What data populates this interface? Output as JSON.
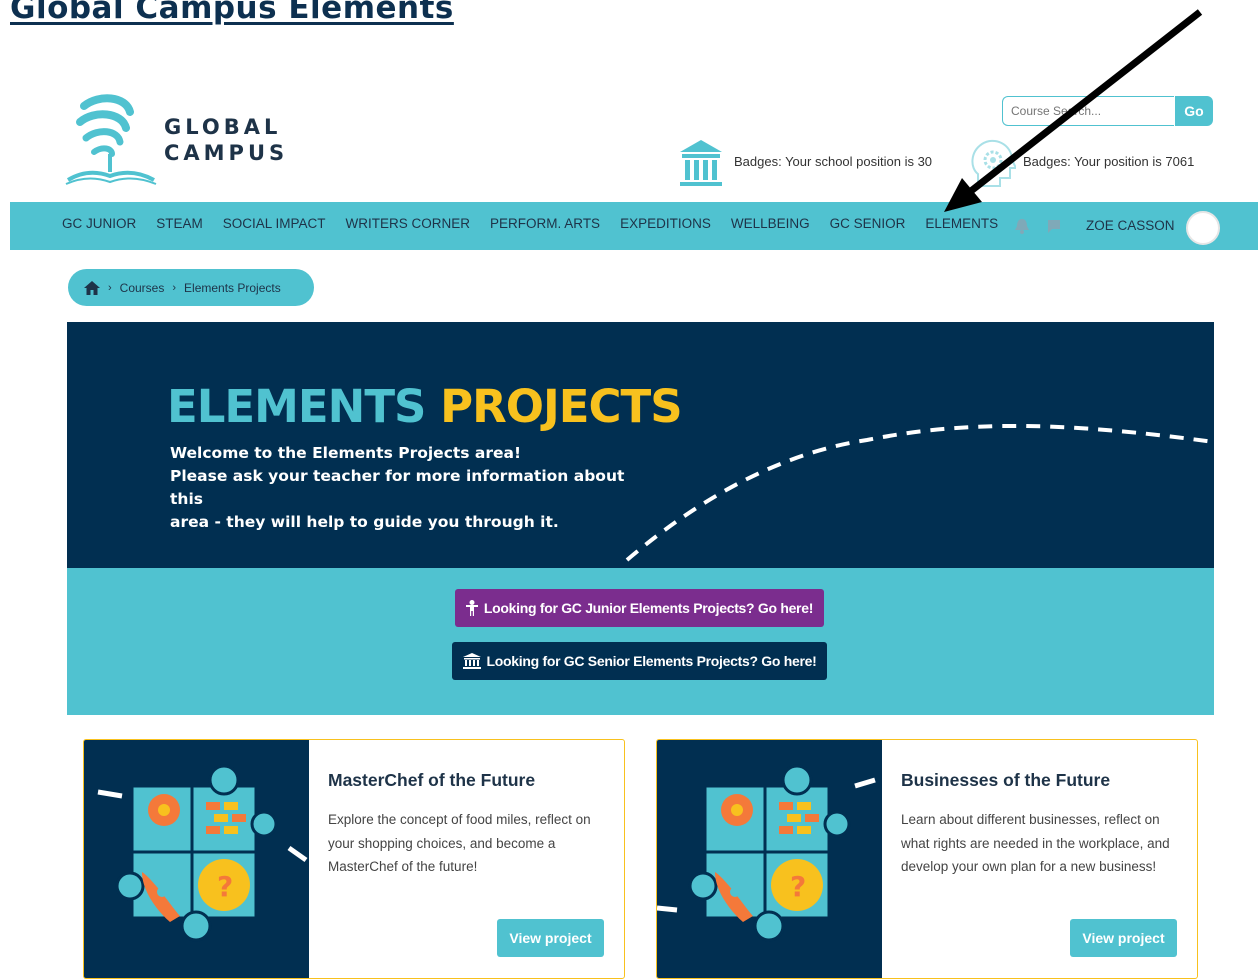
{
  "document": {
    "title": "Global Campus Elements"
  },
  "header": {
    "logo_line1": "GLOBAL",
    "logo_line2": "CAMPUS",
    "search": {
      "placeholder": "Course Search...",
      "button_label": "Go"
    },
    "badges": {
      "school_position": "Badges: Your school position is 30",
      "user_position": "Badges: Your position is 7061"
    }
  },
  "nav": {
    "items": [
      {
        "label": "GC JUNIOR"
      },
      {
        "label": "STEAM"
      },
      {
        "label": "SOCIAL IMPACT"
      },
      {
        "label": "WRITERS CORNER"
      },
      {
        "label": "PERFORM. ARTS"
      },
      {
        "label": "EXPEDITIONS"
      },
      {
        "label": "WELLBEING"
      },
      {
        "label": "GC SENIOR"
      },
      {
        "label": "ELEMENTS"
      }
    ],
    "user_name": "ZOE CASSON"
  },
  "breadcrumb": {
    "items": [
      "Courses",
      "Elements Projects"
    ]
  },
  "hero": {
    "title_part1": "ELEMENTS",
    "title_part2": "PROJECTS",
    "line1": "Welcome to the Elements Projects area!",
    "line2": "Please ask your teacher for more information about this",
    "line3": "area - they will help to guide you through it."
  },
  "cta": {
    "junior_label": "Looking for GC Junior Elements Projects? Go here!",
    "senior_label": "Looking for GC Senior Elements Projects? Go here!"
  },
  "cards": [
    {
      "title": "MasterChef of the Future",
      "description": "Explore the concept of food miles, reflect on your shopping choices, and become a MasterChef of the future!",
      "button_label": "View project"
    },
    {
      "title": "Businesses of the Future",
      "description": "Learn about different businesses, reflect on what rights are needed in the workplace, and develop your own plan for a new business!",
      "button_label": "View project"
    }
  ],
  "colors": {
    "teal": "#50c2d0",
    "navy": "#012f51",
    "yellow": "#f8c11e",
    "purple": "#7b2d8e"
  }
}
